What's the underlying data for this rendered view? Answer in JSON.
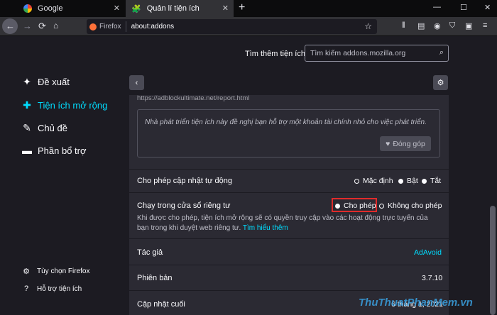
{
  "browser": {
    "tabs": [
      {
        "title": "Google",
        "icon": "google-icon"
      },
      {
        "title": "Quản lí tiện ích",
        "icon": "puzzle-icon"
      }
    ],
    "identity_label": "Firefox",
    "url": "about:addons"
  },
  "search": {
    "label": "Tìm thêm tiện ích",
    "placeholder": "Tìm kiếm addons.mozilla.org"
  },
  "sidebar": {
    "items": [
      {
        "label": "Đề xuất",
        "icon": "sparkle-icon"
      },
      {
        "label": "Tiện ích mở rộng",
        "icon": "puzzle-icon",
        "active": true
      },
      {
        "label": "Chủ đề",
        "icon": "brush-icon"
      },
      {
        "label": "Phần bổ trợ",
        "icon": "plugin-icon"
      }
    ],
    "footer": [
      {
        "label": "Tùy chọn Firefox",
        "icon": "gear-icon"
      },
      {
        "label": "Hỗ trợ tiện ích",
        "icon": "help-icon"
      }
    ]
  },
  "details": {
    "url_partial": "https://adblockultimate.net/report.html",
    "contribution": {
      "text": "Nhà phát triển tiện ích này đề nghị bạn hỗ trợ một khoản tài chính nhỏ cho việc phát triển.",
      "button": "Đóng góp"
    },
    "auto_update": {
      "label": "Cho phép cập nhật tự động",
      "options": [
        "Mặc định",
        "Bật",
        "Tắt"
      ],
      "selected": "Mặc định"
    },
    "private": {
      "label": "Chạy trong cửa sổ riêng tư",
      "options": [
        "Cho phép",
        "Không cho phép"
      ],
      "selected": "Cho phép",
      "description": "Khi được cho phép, tiện ích mở rộng sẽ có quyền truy cập vào các hoạt động trực tuyến của bạn trong khi duyệt web riêng tư.",
      "learn_more": "Tìm hiểu thêm"
    },
    "author": {
      "label": "Tác giả",
      "value": "AdAvoid"
    },
    "version": {
      "label": "Phiên bản",
      "value": "3.7.10"
    },
    "last_updated": {
      "label": "Cập nhật cuối",
      "value": "6 tháng 1, 2021"
    }
  },
  "watermark": "ThuThuatPhanMem.vn",
  "colors": {
    "accent": "#00ddff",
    "highlight": "#e02b2b",
    "background": "#1c1b22",
    "card": "#2b2a33"
  }
}
